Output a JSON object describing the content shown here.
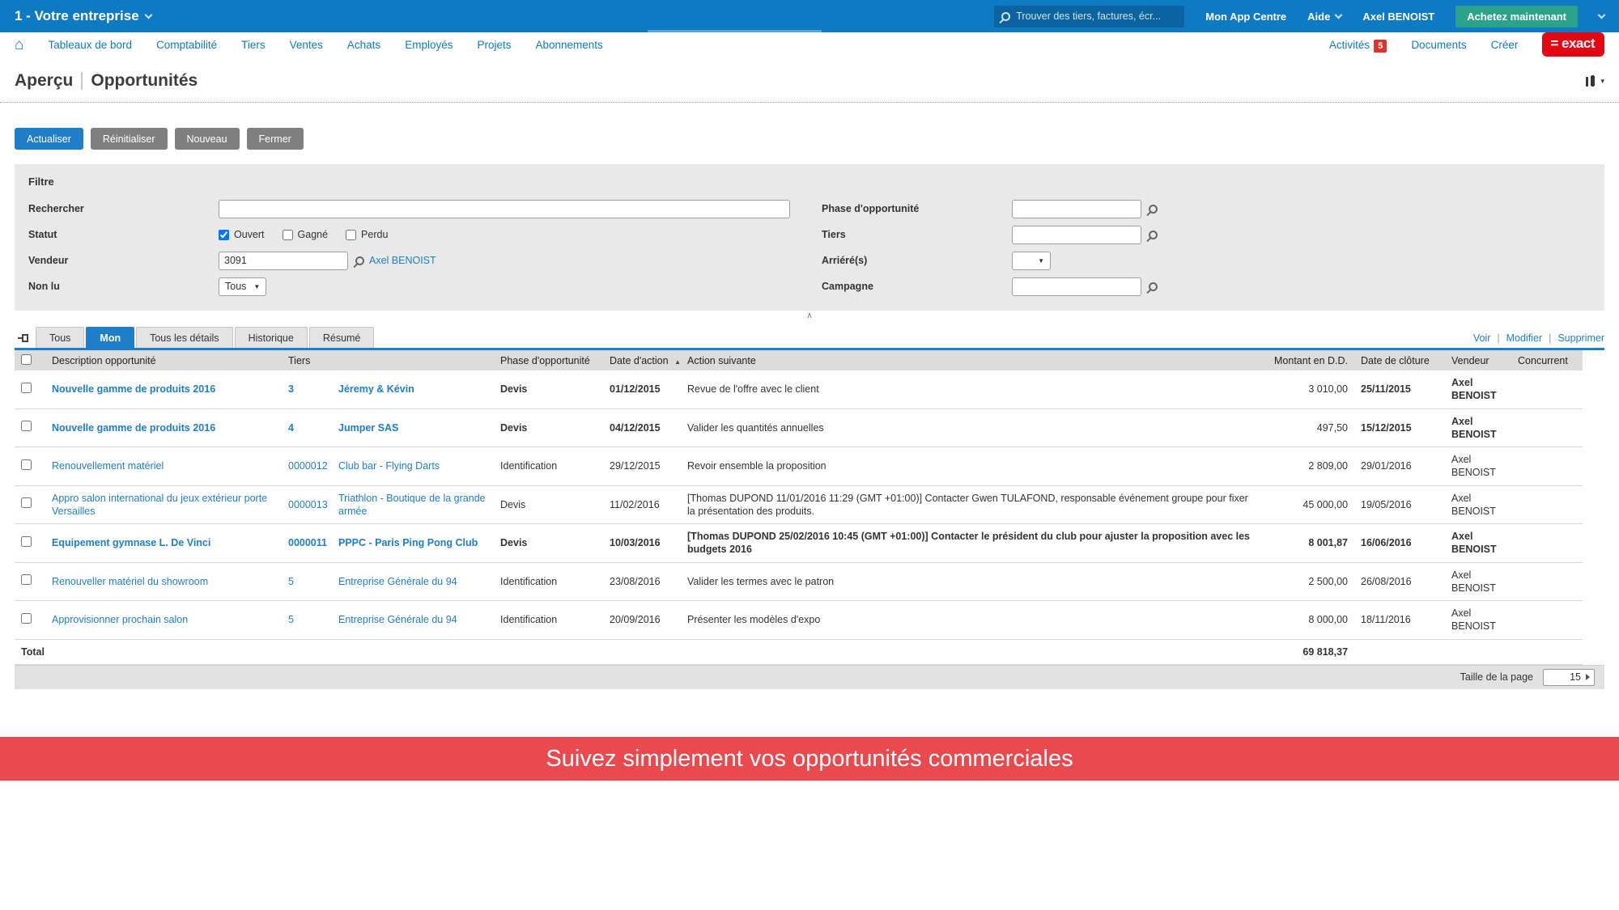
{
  "colors": {
    "topbar_blue": "#0e7ac3",
    "accent_blue": "#1e7ec8",
    "buy_green": "#2ba38a",
    "logo_red": "#e30613",
    "badge_red": "#df322c",
    "banner_red": "#ea494e"
  },
  "icons": {
    "home": "⌂",
    "sort_asc": "▲",
    "caret_down": "▾",
    "select_arrow": "▼",
    "collapse_up": "∧"
  },
  "topbar": {
    "company": "1 - Votre entreprise",
    "search_placeholder": "Trouver des tiers, factures, écr...",
    "app_centre": "Mon App Centre",
    "help": "Aide",
    "user": "Axel BENOIST",
    "buy": "Achetez maintenant"
  },
  "nav": {
    "items": [
      {
        "label": "Tableaux de bord"
      },
      {
        "label": "Comptabilité"
      },
      {
        "label": "Tiers"
      },
      {
        "label": "Ventes"
      },
      {
        "label": "Achats"
      },
      {
        "label": "Employés"
      },
      {
        "label": "Projets"
      },
      {
        "label": "Abonnements"
      }
    ],
    "activities": "Activités",
    "activities_count": "5",
    "documents": "Documents",
    "create": "Créer",
    "logo": "= exact"
  },
  "page": {
    "breadcrumb": "Aperçu",
    "title": "Opportunités"
  },
  "toolbar": {
    "refresh": "Actualiser",
    "reset": "Réinitialiser",
    "new": "Nouveau",
    "close": "Fermer"
  },
  "filter": {
    "title": "Filtre",
    "search_label": "Rechercher",
    "search_value": "",
    "statut_label": "Statut",
    "statut": {
      "options": [
        {
          "label": "Ouvert",
          "checked": true
        },
        {
          "label": "Gagné",
          "checked": false
        },
        {
          "label": "Perdu",
          "checked": false
        }
      ]
    },
    "vendeur_label": "Vendeur",
    "vendeur_value": "3091",
    "vendeur_link": "Axel BENOIST",
    "non_lu_label": "Non lu",
    "non_lu_value": "Tous",
    "phase_label": "Phase d'opportunité",
    "phase_value": "",
    "tiers_label": "Tiers",
    "tiers_value": "",
    "arriere_label": "Arriéré(s)",
    "arriere_value": "",
    "campagne_label": "Campagne",
    "campagne_value": ""
  },
  "tabs": {
    "items": [
      {
        "label": "Tous",
        "active": false
      },
      {
        "label": "Mon",
        "active": true
      },
      {
        "label": "Tous les détails",
        "active": false
      },
      {
        "label": "Historique",
        "active": false
      },
      {
        "label": "Résumé",
        "active": false
      }
    ]
  },
  "actions": {
    "view": "Voir",
    "edit": "Modifier",
    "delete": "Supprimer"
  },
  "table": {
    "headers": {
      "description": "Description opportunité",
      "tiers": "Tiers",
      "phase": "Phase d'opportunité",
      "date_action": "Date d'action",
      "action": "Action suivante",
      "montant": "Montant en D.D.",
      "cloture": "Date de clôture",
      "vendeur": "Vendeur",
      "concurrent": "Concurrent"
    },
    "rows": [
      {
        "description": "Nouvelle gamme de produits 2016",
        "tiers_num": "3",
        "tiers_name": "Jéremy & Kévin",
        "phase": "Devis",
        "date_action": "01/12/2015",
        "action": "Revue de l'offre avec le client",
        "montant": "3 010,00",
        "date_cloture": "25/11/2015",
        "vendeur": "Axel BENOIST",
        "concurrent": "",
        "unread": true,
        "emphasis_amount": false,
        "emphasis_action": false
      },
      {
        "description": "Nouvelle gamme de produits 2016",
        "tiers_num": "4",
        "tiers_name": "Jumper SAS",
        "phase": "Devis",
        "date_action": "04/12/2015",
        "action": "Valider les quantités annuelles",
        "montant": "497,50",
        "date_cloture": "15/12/2015",
        "vendeur": "Axel BENOIST",
        "concurrent": "",
        "unread": true,
        "emphasis_amount": false,
        "emphasis_action": false
      },
      {
        "description": "Renouvellement matériel",
        "tiers_num": "0000012",
        "tiers_name": "Club bar - Flying Darts",
        "phase": "Identification",
        "date_action": "29/12/2015",
        "action": "Revoir ensemble la proposition",
        "montant": "2 809,00",
        "date_cloture": "29/01/2016",
        "vendeur": "Axel BENOIST",
        "concurrent": "",
        "unread": false,
        "emphasis_amount": false,
        "emphasis_action": false
      },
      {
        "description": "Appro salon international du jeux extérieur porte Versailles",
        "tiers_num": "0000013",
        "tiers_name": "Triathlon - Boutique de la grande armée",
        "phase": "Devis",
        "date_action": "11/02/2016",
        "action": "[Thomas DUPOND 11/01/2016 11:29 (GMT +01:00)] Contacter Gwen TULAFOND, responsable événement groupe pour fixer la présentation des produits.",
        "montant": "45 000,00",
        "date_cloture": "19/05/2016",
        "vendeur": "Axel BENOIST",
        "concurrent": "",
        "unread": false,
        "emphasis_amount": false,
        "emphasis_action": false
      },
      {
        "description": "Equipement gymnase L. De Vinci",
        "tiers_num": "0000011",
        "tiers_name": "PPPC - Paris Ping Pong Club",
        "phase": "Devis",
        "date_action": "10/03/2016",
        "action": "[Thomas DUPOND 25/02/2016 10:45 (GMT +01:00)] Contacter le président du club pour ajuster la proposition avec les budgets 2016",
        "montant": "8 001,87",
        "date_cloture": "16/06/2016",
        "vendeur": "Axel BENOIST",
        "concurrent": "",
        "unread": true,
        "emphasis_amount": true,
        "emphasis_action": true
      },
      {
        "description": "Renouveller matériel du showroom",
        "tiers_num": "5",
        "tiers_name": "Entreprise Générale du 94",
        "phase": "Identification",
        "date_action": "23/08/2016",
        "action": "Valider les termes avec le patron",
        "montant": "2 500,00",
        "date_cloture": "26/08/2016",
        "vendeur": "Axel BENOIST",
        "concurrent": "",
        "unread": false,
        "emphasis_amount": false,
        "emphasis_action": false
      },
      {
        "description": "Approvisionner prochain salon",
        "tiers_num": "5",
        "tiers_name": "Entreprise Générale du 94",
        "phase": "Identification",
        "date_action": "20/09/2016",
        "action": "Présenter les modèles d'expo",
        "montant": "8 000,00",
        "date_cloture": "18/11/2016",
        "vendeur": "Axel BENOIST",
        "concurrent": "",
        "unread": false,
        "emphasis_amount": false,
        "emphasis_action": false
      }
    ],
    "total_label": "Total",
    "total_value": "69 818,37"
  },
  "pagination": {
    "label": "Taille de la page",
    "value": "15"
  },
  "banner": {
    "text": "Suivez simplement vos opportunités commerciales"
  }
}
